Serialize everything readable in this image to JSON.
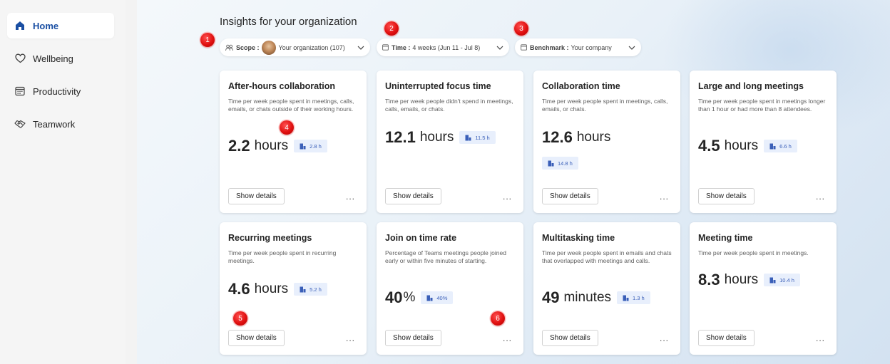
{
  "colors": {
    "accent": "#1a4fa3",
    "badge_bg": "#e8effc",
    "badge_text": "#3a5fb8",
    "marker": "#e01010"
  },
  "sidebar": {
    "items": [
      {
        "label": "Home",
        "icon": "home-icon",
        "active": true
      },
      {
        "label": "Wellbeing",
        "icon": "heart-icon",
        "active": false
      },
      {
        "label": "Productivity",
        "icon": "calendar-icon",
        "active": false
      },
      {
        "label": "Teamwork",
        "icon": "handshake-icon",
        "active": false
      }
    ]
  },
  "header": {
    "title": "Insights for your organization",
    "filters": {
      "scope": {
        "label": "Scope :",
        "value": "Your organization (107)"
      },
      "time": {
        "label": "Time :",
        "value": "4 weeks (Jun 11 - Jul 8)"
      },
      "benchmark": {
        "label": "Benchmark :",
        "value": "Your company"
      }
    }
  },
  "cards": [
    {
      "title": "After-hours collaboration",
      "desc": "Time per week people spent in meetings, calls, emails, or chats outside of their working hours.",
      "value": "2.2",
      "unit": "hours",
      "benchmark": "2.8 h",
      "button": "Show details",
      "more": "..."
    },
    {
      "title": "Uninterrupted focus time",
      "desc": "Time per week people didn't spend in meetings, calls, emails, or chats.",
      "value": "12.1",
      "unit": "hours",
      "benchmark": "11.5 h",
      "button": "Show details",
      "more": "..."
    },
    {
      "title": "Collaboration time",
      "desc": "Time per week people spent in meetings, calls, emails, or chats.",
      "value": "12.6",
      "unit": "hours",
      "benchmark": "14.8 h",
      "button": "Show details",
      "more": "..."
    },
    {
      "title": "Large and long meetings",
      "desc": "Time per week people spent in meetings longer than 1 hour or had more than 8 attendees.",
      "value": "4.5",
      "unit": "hours",
      "benchmark": "6.6 h",
      "button": "Show details",
      "more": "..."
    },
    {
      "title": "Recurring meetings",
      "desc": "Time per week people spent in recurring meetings.",
      "value": "4.6",
      "unit": "hours",
      "benchmark": "5.2 h",
      "button": "Show details",
      "more": "..."
    },
    {
      "title": "Join on time rate",
      "desc": "Percentage of Teams meetings people joined early or within five minutes of starting.",
      "value": "40",
      "unit": "%",
      "benchmark": "40%",
      "button": "Show details",
      "more": "..."
    },
    {
      "title": "Multitasking time",
      "desc": "Time per week people spent in emails and chats that overlapped with meetings and calls.",
      "value": "49",
      "unit": "minutes",
      "benchmark": "1.3 h",
      "button": "Show details",
      "more": "..."
    },
    {
      "title": "Meeting time",
      "desc": "Time per week people spent in meetings.",
      "value": "8.3",
      "unit": "hours",
      "benchmark": "10.4 h",
      "button": "Show details",
      "more": "..."
    }
  ],
  "markers": [
    "1",
    "2",
    "3",
    "4",
    "5",
    "6"
  ]
}
